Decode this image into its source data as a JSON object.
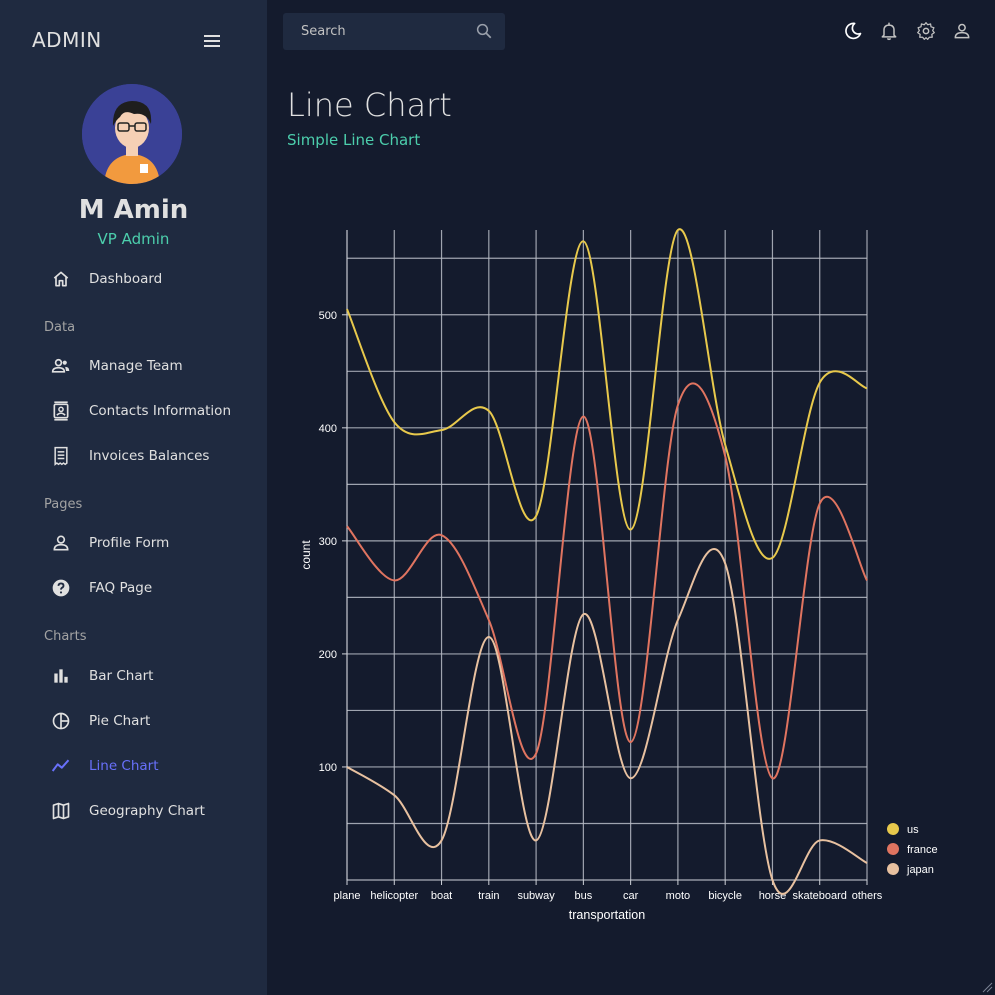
{
  "app": {
    "brand": "ADMIN"
  },
  "user": {
    "name": "M Amin",
    "role": "VP Admin"
  },
  "nav": {
    "dashboard": "Dashboard",
    "sections": {
      "data": "Data",
      "pages": "Pages",
      "charts": "Charts"
    },
    "items": [
      {
        "label": "Manage Team",
        "icon": "people-icon"
      },
      {
        "label": "Contacts Information",
        "icon": "contacts-icon"
      },
      {
        "label": "Invoices Balances",
        "icon": "receipt-icon"
      },
      {
        "label": "Profile Form",
        "icon": "person-icon"
      },
      {
        "label": "FAQ Page",
        "icon": "help-icon"
      },
      {
        "label": "Bar Chart",
        "icon": "bar-chart-icon"
      },
      {
        "label": "Pie Chart",
        "icon": "pie-chart-icon"
      },
      {
        "label": "Line Chart",
        "icon": "line-chart-icon"
      },
      {
        "label": "Geography Chart",
        "icon": "map-icon"
      }
    ],
    "active": "Line Chart"
  },
  "search": {
    "placeholder": "Search"
  },
  "header": {
    "title": "Line Chart",
    "subtitle": "Simple Line Chart"
  },
  "colors": {
    "accent_green": "#4cceac",
    "accent_blue": "#6870fa",
    "us": "#e8c94c",
    "france": "#e07460",
    "japan": "#e8c1a0"
  },
  "chart_data": {
    "type": "line",
    "categories": [
      "plane",
      "helicopter",
      "boat",
      "train",
      "subway",
      "bus",
      "car",
      "moto",
      "bicycle",
      "horse",
      "skateboard",
      "others"
    ],
    "series": [
      {
        "name": "us",
        "values": [
          505,
          405,
          398,
          415,
          322,
          565,
          310,
          575,
          385,
          285,
          440,
          435
        ]
      },
      {
        "name": "france",
        "values": [
          313,
          265,
          305,
          230,
          112,
          410,
          122,
          420,
          375,
          90,
          333,
          265
        ]
      },
      {
        "name": "japan",
        "values": [
          100,
          75,
          35,
          215,
          35,
          235,
          90,
          230,
          280,
          0,
          35,
          15
        ]
      }
    ],
    "xlabel": "transportation",
    "ylabel": "count",
    "ylim": [
      0,
      575
    ],
    "yticks": [
      100,
      200,
      300,
      400,
      500
    ],
    "grid": true,
    "legend": "bottom-right"
  }
}
